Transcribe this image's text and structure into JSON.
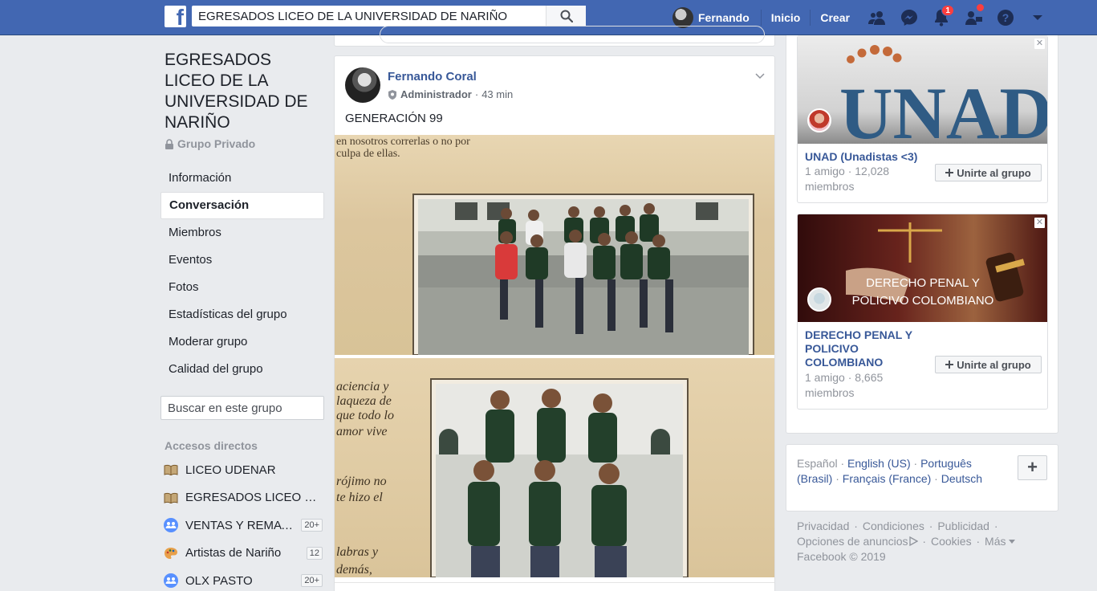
{
  "topbar": {
    "logo_letter": "f",
    "search_value": "EGRESADOS LICEO DE LA UNIVERSIDAD DE NARIÑO",
    "profile_name": "Fernando",
    "nav_home": "Inicio",
    "nav_create": "Crear",
    "notifications_count": "1"
  },
  "group": {
    "title": "EGRESADOS LICEO DE LA UNIVERSIDAD DE NARIÑO",
    "privacy": "Grupo Privado",
    "menu": [
      {
        "label": "Información"
      },
      {
        "label": "Conversación"
      },
      {
        "label": "Miembros"
      },
      {
        "label": "Eventos"
      },
      {
        "label": "Fotos"
      },
      {
        "label": "Estadísticas del grupo"
      },
      {
        "label": "Moderar grupo"
      },
      {
        "label": "Calidad del grupo"
      }
    ],
    "search_placeholder": "Buscar en este grupo",
    "shortcuts_title": "Accesos directos",
    "shortcuts": [
      {
        "label": "LICEO UDENAR",
        "count": "",
        "icon": "book-icon"
      },
      {
        "label": "EGRESADOS LICEO D...",
        "count": "",
        "icon": "book-icon"
      },
      {
        "label": "VENTAS Y REMATES...",
        "count": "20+",
        "icon": "group-icon"
      },
      {
        "label": "Artistas de Nariño",
        "count": "12",
        "icon": "palette-icon"
      },
      {
        "label": "OLX PASTO",
        "count": "20+",
        "icon": "group-icon"
      }
    ]
  },
  "post": {
    "author": "Fernando Coral",
    "role": "Administrador",
    "time": "43 min",
    "text": "GENERACIÓN 99",
    "photo1_text_line1": "en nosotros correrlas o no por",
    "photo1_text_line2": "culpa de ellas.",
    "photo2_text": [
      "aciencia y",
      "laqueza de",
      "que todo lo",
      "amor vive",
      "",
      "rójimo no",
      "te hizo el",
      "",
      "labras y",
      "demás,"
    ]
  },
  "ads": [
    {
      "name": "UNAD (Unadistas <3)",
      "stats": "1 amigo · 12,028 miembros",
      "button": "Unirte al grupo",
      "image_text": "UNAD"
    },
    {
      "name": "DERECHO PENAL Y POLICIVO COLOMBIANO",
      "stats": "1 amigo · 8,665 miembros",
      "button": "Unirte al grupo",
      "image_text_1": "DERECHO PENAL Y",
      "image_text_2": "POLICIVO COLOMBIANO"
    }
  ],
  "languages": {
    "current": "Español",
    "links": [
      "English (US)",
      "Português (Brasil)",
      "Français (France)",
      "Deutsch"
    ],
    "add": "+"
  },
  "footer": {
    "links": [
      "Privacidad",
      "Condiciones",
      "Publicidad",
      "Opciones de anuncios",
      "Cookies",
      "Más"
    ],
    "copyright": "Facebook © 2019"
  },
  "colors": {
    "brand": "#4267b2",
    "link": "#385898",
    "badge": "#fa3e3e"
  }
}
